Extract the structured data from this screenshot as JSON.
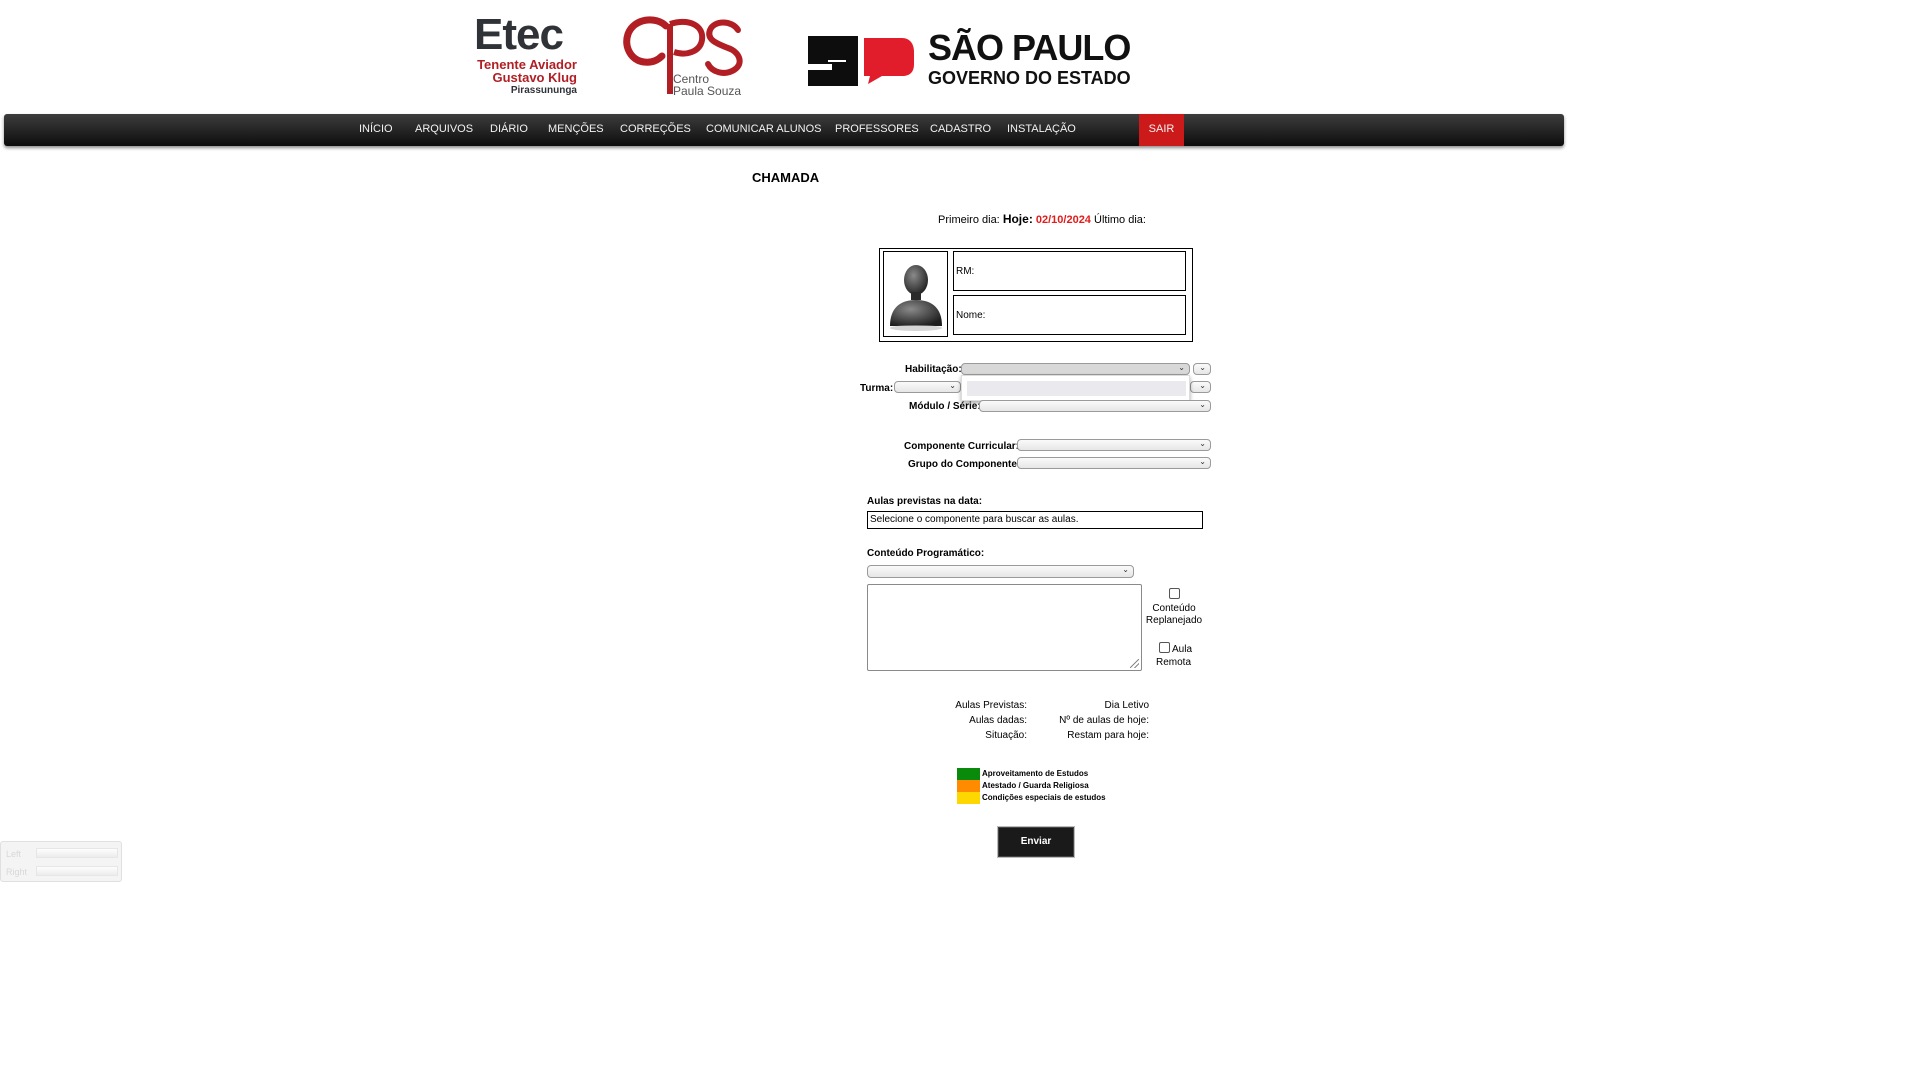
{
  "header": {
    "etec_logo": {
      "word": "Etec",
      "line1": "Tenente Aviador",
      "line2": "Gustavo Klug",
      "line3": "Pirassununga"
    },
    "cps_logo": {
      "line1": "Centro",
      "line2": "Paula Souza"
    },
    "sp_logo": {
      "line1": "SÃO PAULO",
      "line2": "GOVERNO DO ESTADO"
    }
  },
  "nav": {
    "items": [
      "INÍCIO",
      "ARQUIVOS",
      "DIÁRIO",
      "MENÇÕES",
      "CORREÇÕES",
      "COMUNICAR ALUNOS",
      "PROFESSORES",
      "CADASTRO",
      "INSTALAÇÃO"
    ],
    "exit": "SAIR"
  },
  "page": {
    "title": "CHAMADA",
    "date": {
      "first_label": "Primeiro dia:",
      "today_label": "Hoje:",
      "today_value": "02/10/2024",
      "last_label": "Último dia:"
    },
    "student": {
      "rm_label": "RM:",
      "nome_label": "Nome:"
    },
    "filters": {
      "habilitacao_label": "Habilitação:",
      "turma_label": "Turma:",
      "modulo_label": "Módulo / Série:",
      "componente_label": "Componente Curricular:",
      "grupo_label": "Grupo do Componente:"
    },
    "aulas": {
      "label": "Aulas previstas na data:",
      "value": "Selecione o componente para buscar as aulas."
    },
    "conteudo": {
      "label": "Conteúdo Programático:",
      "replanejado_line1": "Conteúdo",
      "replanejado_line2": "Replanejado",
      "remota_line1": "Aula",
      "remota_line2": "Remota"
    },
    "stats": {
      "aulas_previstas": "Aulas Previstas:",
      "aulas_dadas": "Aulas dadas:",
      "situacao": "Situação:",
      "dia_letivo": "Dia Letivo",
      "n_aulas_hoje": "Nº de aulas de hoje:",
      "restam_hoje": "Restam para hoje:"
    },
    "legend": [
      {
        "label": "Aproveitamento de Estudos",
        "color": "#0a8a0a"
      },
      {
        "label": "Atestado / Guarda Religiosa",
        "color": "#ff8c00"
      },
      {
        "label": "Condições especiais de estudos",
        "color": "#ffd700"
      }
    ],
    "submit_label": "Enviar"
  },
  "widget": {
    "left": "Left",
    "right": "Right"
  },
  "colors": {
    "nav_bg": "#1f1f1f",
    "exit_bg": "#cc1a1a",
    "today_red": "#e31b1b",
    "brand_red": "#b11f24"
  }
}
